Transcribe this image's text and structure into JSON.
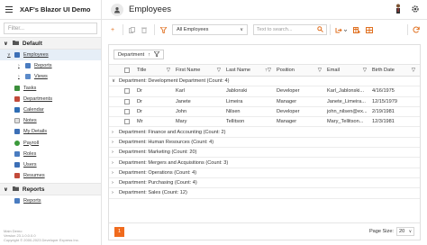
{
  "header": {
    "app_title": "XAF's Blazor UI Demo",
    "page_title": "Employees"
  },
  "sidebar": {
    "filter_placeholder": "Filter...",
    "groups": [
      {
        "label": "Default"
      },
      {
        "label": "Reports"
      }
    ],
    "items": [
      {
        "label": "Employees"
      },
      {
        "label": "Reports"
      },
      {
        "label": "Views"
      },
      {
        "label": "Tasks"
      },
      {
        "label": "Departments"
      },
      {
        "label": "Calendar"
      },
      {
        "label": "Notes"
      },
      {
        "label": "My Details"
      },
      {
        "label": "Payroll"
      },
      {
        "label": "Roles"
      },
      {
        "label": "Users"
      },
      {
        "label": "Resumes"
      },
      {
        "label": "Reports"
      }
    ],
    "footer": [
      "Main Demo",
      "Version 23.1.0.0.0.0",
      "Copyright © 2000-2023 Developer Express Inc."
    ]
  },
  "toolbar": {
    "view_select": "All Employees",
    "search_placeholder": "Text to search..."
  },
  "grid": {
    "group_chip": "Department",
    "columns": [
      "Title",
      "First Name",
      "Last Name",
      "Position",
      "Email",
      "Birth Date"
    ],
    "expanded_group": "Department: Development Department (Count: 4)",
    "rows": [
      {
        "title": "Dr",
        "first": "Karl",
        "last": "Jablonski",
        "position": "Developer",
        "email": "Karl_Jablonski...",
        "birth": "4/16/1975"
      },
      {
        "title": "Dr",
        "first": "Janete",
        "last": "Limeira",
        "position": "Manager",
        "email": "Janete_Limeira...",
        "birth": "12/15/1979"
      },
      {
        "title": "Dr",
        "first": "John",
        "last": "Nilsen",
        "position": "Developer",
        "email": "john_nilsen@ex...",
        "birth": "2/19/1981"
      },
      {
        "title": "Mr",
        "first": "Mary",
        "last": "Tellitson",
        "position": "Manager",
        "email": "Mary_Tellitson...",
        "birth": "12/3/1981"
      }
    ],
    "groups": [
      "Department: Finance and Accounting (Count: 2)",
      "Department: Human Resources (Count: 4)",
      "Department: Marketing (Count: 20)",
      "Department: Mergers and Acquisitions (Count: 3)",
      "Department: Operations (Count: 4)",
      "Department: Purchasing (Count: 4)",
      "Department: Sales (Count: 12)"
    ],
    "page_number": "1",
    "page_size_label": "Page Size:",
    "page_size": "20"
  }
}
